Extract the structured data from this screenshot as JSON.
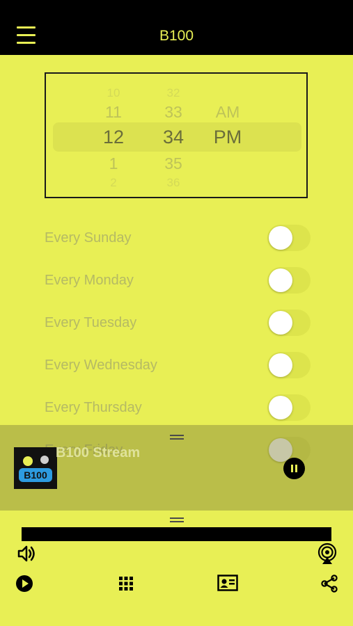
{
  "header": {
    "title": "B100",
    "menu_icon": "hamburger-menu-icon"
  },
  "time_picker": {
    "hours": [
      "10",
      "11",
      "12",
      "1",
      "2"
    ],
    "minutes": [
      "32",
      "33",
      "34",
      "35",
      "36"
    ],
    "periods": [
      "",
      "AM",
      "PM",
      "",
      ""
    ],
    "selected": {
      "hour": "12",
      "minute": "34",
      "period": "PM"
    }
  },
  "schedule": {
    "rows": [
      {
        "label": "Every Sunday",
        "enabled": false
      },
      {
        "label": "Every Monday",
        "enabled": false
      },
      {
        "label": "Every Tuesday",
        "enabled": false
      },
      {
        "label": "Every Wednesday",
        "enabled": false
      },
      {
        "label": "Every Thursday",
        "enabled": false
      },
      {
        "label": "Every Friday",
        "enabled": false
      }
    ]
  },
  "player": {
    "station_title": "B100 Stream",
    "artwork_text": "B100",
    "state": "playing"
  },
  "bottom_bar": {
    "icons": [
      "volume-icon",
      "airplay-icon",
      "play-icon",
      "grid-icon",
      "contact-card-icon",
      "share-icon"
    ]
  },
  "colors": {
    "background": "#e8ef55",
    "header": "#000000",
    "accent": "#e8ef55"
  }
}
